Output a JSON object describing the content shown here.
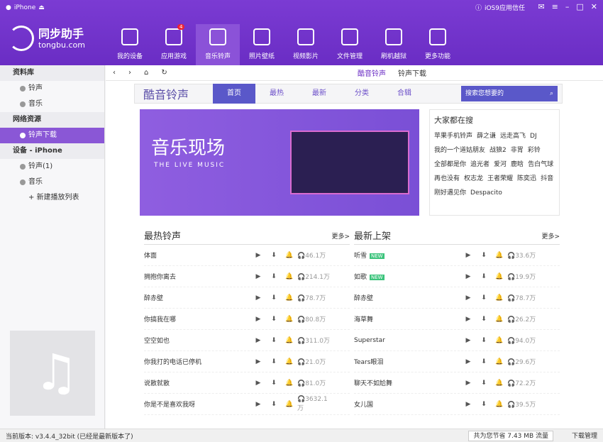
{
  "titlebar": {
    "device": "iPhone",
    "trust": "iOS9应用信任"
  },
  "logo": {
    "name": "同步助手",
    "domain": "tongbu.com"
  },
  "nav": [
    {
      "label": "我的设备"
    },
    {
      "label": "应用游戏",
      "badge": "4"
    },
    {
      "label": "音乐铃声"
    },
    {
      "label": "照片壁纸"
    },
    {
      "label": "视频影片"
    },
    {
      "label": "文件管理"
    },
    {
      "label": "刷机越狱"
    },
    {
      "label": "更多功能"
    }
  ],
  "sidebar": {
    "lib": "资料库",
    "ringtone": "铃声",
    "music": "音乐",
    "net": "网络资源",
    "ringdl": "铃声下载",
    "device": "设备 - iPhone",
    "ring1": "铃声(1)",
    "music2": "音乐",
    "newlist": "新建播放列表"
  },
  "subtabs": {
    "a": "酷音铃声",
    "b": "铃声下载"
  },
  "header": {
    "brand": "酷音铃声",
    "tabs": [
      "首页",
      "最热",
      "最新",
      "分类",
      "合辑"
    ],
    "search": "搜索您想要的"
  },
  "banner": {
    "title": "音乐现场",
    "sub": "THE LIVE MUSIC"
  },
  "hot": {
    "title": "大家都在搜",
    "tags": [
      "苹果手机铃声",
      "薛之谦",
      "远走高飞",
      "DJ",
      "我的一个道姑朋友",
      "战狼2",
      "非胃",
      "彩铃",
      "全部都是你",
      "追光者",
      "爱河",
      "鹿晗",
      "告白气球",
      "再也没有",
      "权志龙",
      "王者荣耀",
      "陈奕迅",
      "抖音",
      "刚好遇见你",
      "Despacito"
    ]
  },
  "left": {
    "title": "最热铃声",
    "more": "更多>",
    "rows": [
      {
        "n": "体面",
        "c": "46.1万"
      },
      {
        "n": "拥抱你离去",
        "c": "214.1万"
      },
      {
        "n": "醉赤壁",
        "c": "78.7万"
      },
      {
        "n": "你搞我在哪",
        "c": "80.8万"
      },
      {
        "n": "空空如也",
        "c": "311.0万"
      },
      {
        "n": "你我打的电话已停机",
        "c": "21.0万"
      },
      {
        "n": "说散就散",
        "c": "81.0万"
      },
      {
        "n": "你是不是喜欢我呀",
        "c": "3632.1万"
      }
    ]
  },
  "right": {
    "title": "最新上架",
    "more": "更多>",
    "rows": [
      {
        "n": "听雪",
        "new": "NEW",
        "c": "33.6万"
      },
      {
        "n": "如歌",
        "new": "NEW",
        "c": "19.9万"
      },
      {
        "n": "醉赤壁",
        "c": "78.7万"
      },
      {
        "n": "海草舞",
        "c": "26.2万"
      },
      {
        "n": "Superstar",
        "c": "94.0万"
      },
      {
        "n": "Tears眼泪",
        "c": "29.6万"
      },
      {
        "n": "聊天不如尬舞",
        "c": "72.2万"
      },
      {
        "n": "女儿国",
        "c": "39.5万"
      }
    ]
  },
  "status": {
    "version": "当前版本: v3.4.4_32bit (已经是最新版本了)",
    "save": "共为您节省 7.43 MB 流量",
    "dl": "下载管理"
  }
}
